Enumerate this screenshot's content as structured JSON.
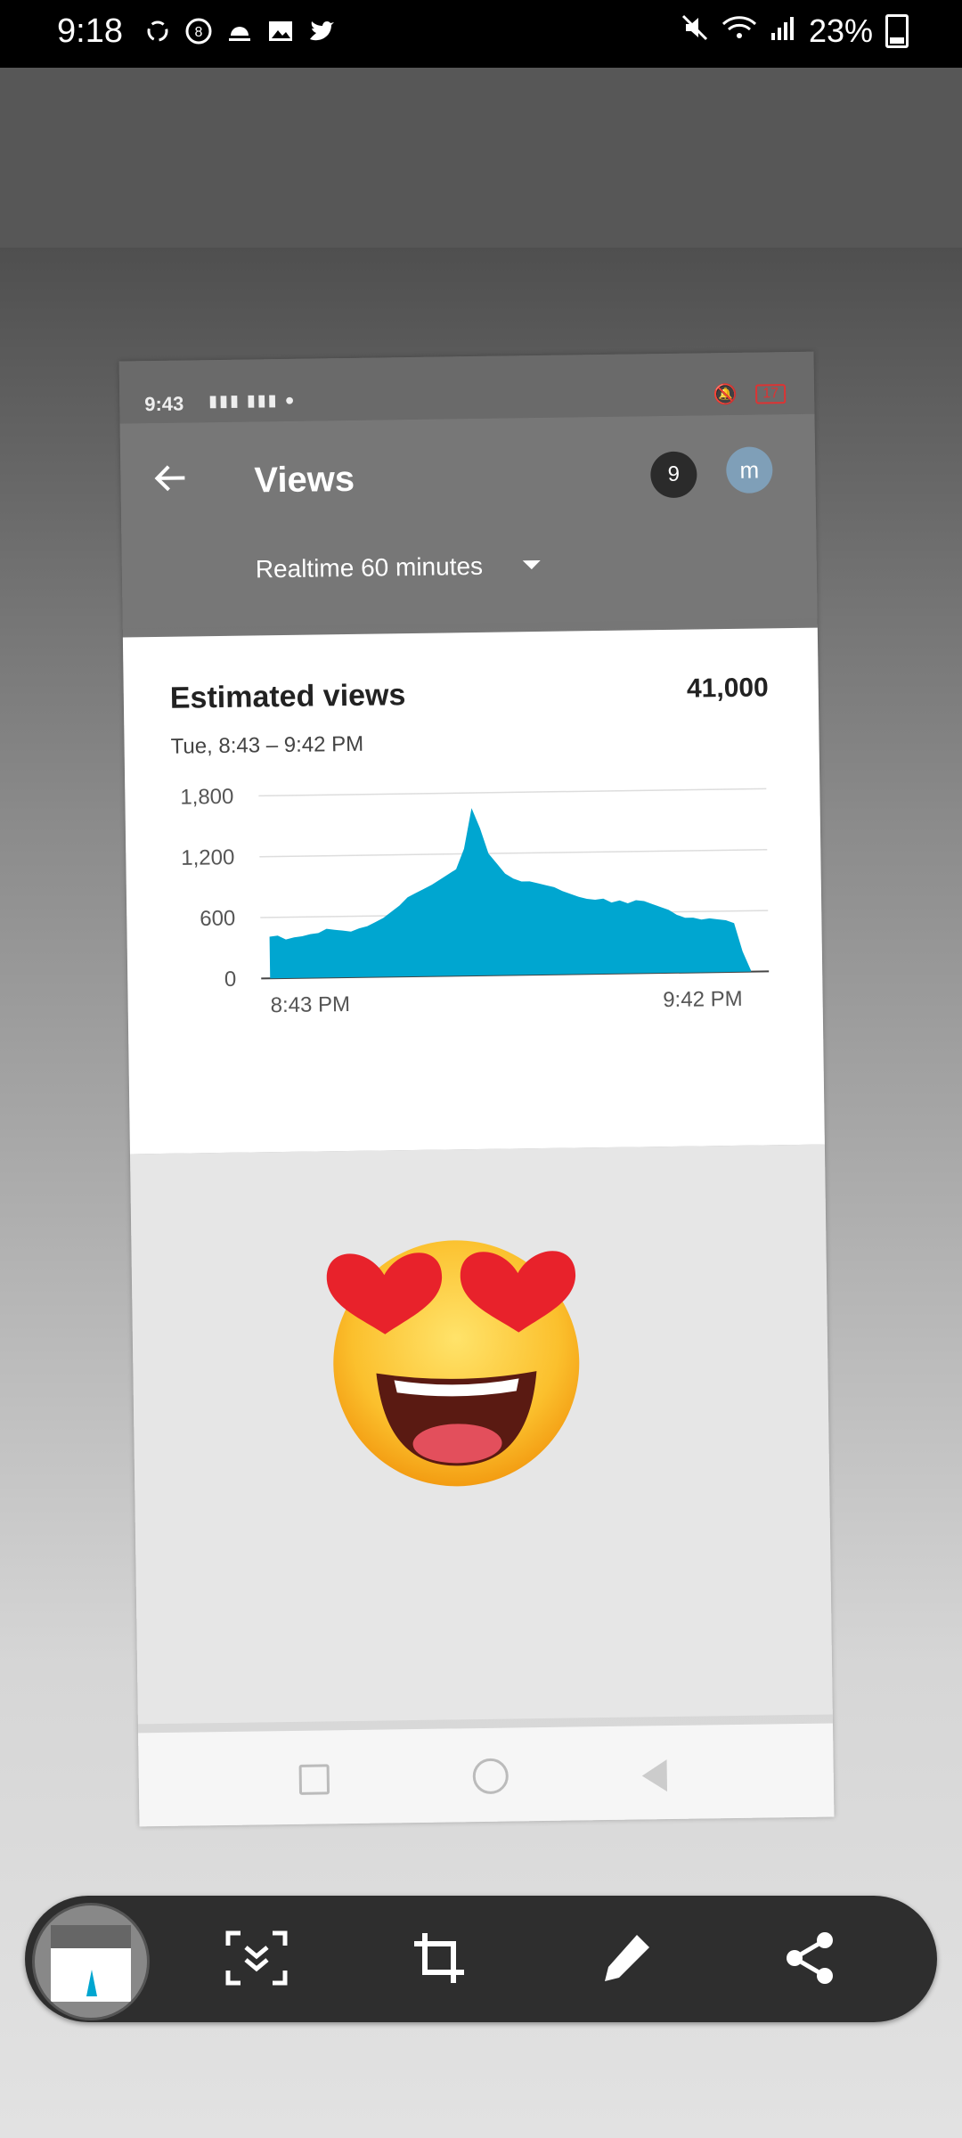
{
  "status_bar": {
    "time": "9:18",
    "notification_icons": [
      "sync-icon",
      "counter-icon",
      "weather-icon",
      "gallery-icon",
      "twitter-icon"
    ],
    "battery_percent": "23%"
  },
  "captured_screen": {
    "status_bar": {
      "time": "9:43",
      "battery": "17"
    },
    "app_bar": {
      "title": "Views",
      "notification_badge": "9",
      "avatar_initial": "m",
      "range_selector": "Realtime 60 minutes"
    },
    "card": {
      "title": "Estimated views",
      "total": "41,000",
      "subtitle": "Tue, 8:43 – 9:42 PM"
    },
    "chart_data": {
      "type": "area",
      "title": "Estimated views",
      "x_tick_labels": [
        "8:43 PM",
        "9:42 PM"
      ],
      "y_tick_labels": [
        "1,800",
        "1,200",
        "600",
        "0"
      ],
      "ylim": [
        0,
        1800
      ],
      "grid": true,
      "color": "#00a6d0",
      "x": [
        0,
        1,
        2,
        3,
        4,
        5,
        6,
        7,
        8,
        9,
        10,
        11,
        12,
        13,
        14,
        15,
        16,
        17,
        18,
        19,
        20,
        21,
        22,
        23,
        24,
        25,
        26,
        27,
        28,
        29,
        30,
        31,
        32,
        33,
        34,
        35,
        36,
        37,
        38,
        39,
        40,
        41,
        42,
        43,
        44,
        45,
        46,
        47,
        48,
        49,
        50,
        51,
        52,
        53,
        54,
        55,
        56,
        57,
        58,
        59
      ],
      "values": [
        410,
        420,
        380,
        400,
        410,
        430,
        440,
        480,
        470,
        460,
        450,
        480,
        500,
        540,
        580,
        640,
        700,
        780,
        820,
        860,
        900,
        950,
        1000,
        1050,
        1250,
        1650,
        1450,
        1200,
        1100,
        1000,
        950,
        920,
        920,
        900,
        880,
        860,
        820,
        790,
        760,
        740,
        730,
        740,
        700,
        720,
        690,
        720,
        710,
        680,
        650,
        620,
        570,
        540,
        540,
        520,
        530,
        520,
        510,
        480,
        200,
        10
      ]
    },
    "emoji": "smiling-face-with-heart-eyes"
  },
  "toolbar": {
    "tools": [
      "scroll-capture-icon",
      "crop-icon",
      "draw-icon",
      "share-icon"
    ]
  },
  "colors": {
    "chart_fill": "#00a6d0",
    "toolbar_bg": "#2e2e2e"
  }
}
